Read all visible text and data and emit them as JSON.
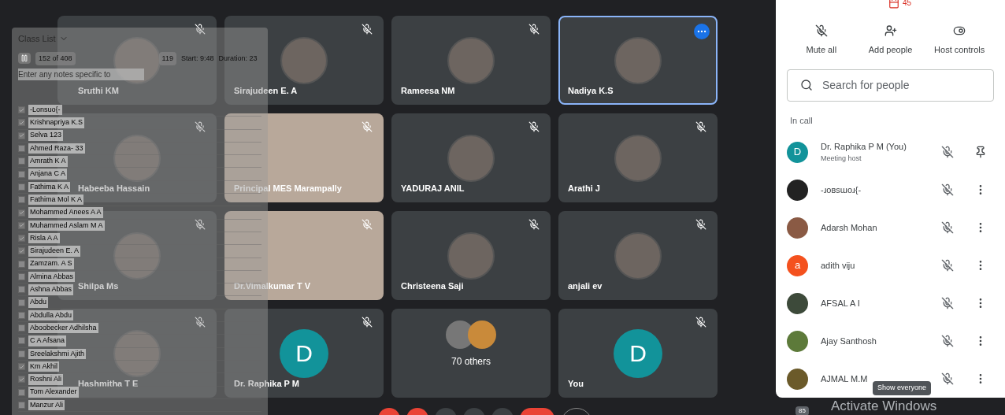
{
  "tiles": [
    {
      "name": "Sruthi KM",
      "kind": "photo",
      "muted": true,
      "selected": false
    },
    {
      "name": "Sirajudeen E. A",
      "kind": "photo",
      "muted": true,
      "selected": false
    },
    {
      "name": "Rameesa NM",
      "kind": "photo",
      "muted": true,
      "selected": false
    },
    {
      "name": "Nadiya K.S",
      "kind": "photo",
      "muted": false,
      "selected": true
    },
    {
      "name": "Habeeba Hassain",
      "kind": "photo",
      "muted": true,
      "selected": false
    },
    {
      "name": "Principal MES Marampally",
      "kind": "video",
      "muted": true,
      "selected": false
    },
    {
      "name": "YADURAJ ANIL",
      "kind": "photo",
      "muted": true,
      "selected": false
    },
    {
      "name": "Arathi J",
      "kind": "photo",
      "muted": true,
      "selected": false
    },
    {
      "name": "Shilpa Ms",
      "kind": "photo",
      "muted": true,
      "selected": false
    },
    {
      "name": "Dr.Vimalkumar T V",
      "kind": "video",
      "muted": true,
      "selected": false
    },
    {
      "name": "Christeena Saji",
      "kind": "photo",
      "muted": true,
      "selected": false
    },
    {
      "name": "anjali ev",
      "kind": "photo",
      "muted": true,
      "selected": false
    },
    {
      "name": "Hashmitha T E",
      "kind": "photo",
      "muted": true,
      "selected": false
    },
    {
      "name": "Dr. Raphika P M",
      "kind": "letter",
      "letter": "D",
      "muted": true,
      "selected": false
    },
    {
      "name": "70 others",
      "kind": "group",
      "muted": false,
      "selected": false
    },
    {
      "name": "You",
      "kind": "letter",
      "letter": "D",
      "muted": true,
      "selected": false
    }
  ],
  "class_list": {
    "title": "Class List",
    "count": "152 of 408",
    "count_2": "119",
    "start": "Start: 9:48",
    "duration": "Duration: 23",
    "notes_placeholder": "Enter any notes specific to",
    "rows": [
      {
        "name": "-Lonsuo{-",
        "checked": true
      },
      {
        "name": "Krishnapriya K.S",
        "checked": true
      },
      {
        "name": "Selva 123",
        "checked": true
      },
      {
        "name": "Ahmed Raza- 33",
        "checked": false
      },
      {
        "name": "Amrath K A",
        "checked": false
      },
      {
        "name": "Anjana C A",
        "checked": false
      },
      {
        "name": "Fathima K A",
        "checked": false
      },
      {
        "name": "Fathima Mol K A",
        "checked": false
      },
      {
        "name": "Mohammed Anees A A",
        "checked": true
      },
      {
        "name": "Muhammed Aslam M A",
        "checked": true
      },
      {
        "name": "Risla A A",
        "checked": true
      },
      {
        "name": "Sirajudeen E. A",
        "checked": true
      },
      {
        "name": "Zamzam. A S",
        "checked": false
      },
      {
        "name": "Almina Abbas",
        "checked": false
      },
      {
        "name": "Ashna Abbas",
        "checked": false
      },
      {
        "name": "Abdu",
        "checked": false
      },
      {
        "name": "Abdulla Abdu",
        "checked": false
      },
      {
        "name": "Aboobecker Adhilsha",
        "checked": false
      },
      {
        "name": "C A Afsana",
        "checked": false
      },
      {
        "name": "Sreelakshmi Ajith",
        "checked": false
      },
      {
        "name": "Km Akhil",
        "checked": true
      },
      {
        "name": "Roshni Ali",
        "checked": true
      },
      {
        "name": "Tom Alexander",
        "checked": false
      },
      {
        "name": "Manzur Ali",
        "checked": false
      }
    ]
  },
  "panel": {
    "top_count": "45",
    "actions": [
      "Mute all",
      "Add people",
      "Host controls"
    ],
    "search_placeholder": "Search for people",
    "section": "In call",
    "people": [
      {
        "name": "Dr. Raphika P M (You)",
        "subtitle": "Meeting host",
        "kind": "letter",
        "letter": "D",
        "color": "#12939a",
        "pinnable": true
      },
      {
        "name": "-ɹoʙsɯoɹ{-",
        "kind": "photo",
        "color": "#222222",
        "pinnable": false
      },
      {
        "name": "Adarsh Mohan",
        "kind": "photo",
        "color": "#8a5a44",
        "pinnable": false
      },
      {
        "name": "adith viju",
        "kind": "letter",
        "letter": "a",
        "color": "#f4511e",
        "pinnable": false
      },
      {
        "name": "AFSAL A I",
        "kind": "photo",
        "color": "#3d4a3a",
        "pinnable": false
      },
      {
        "name": "Ajay Santhosh",
        "kind": "photo",
        "color": "#5d7a3a",
        "pinnable": false
      },
      {
        "name": "AJMAL M.M",
        "kind": "photo",
        "color": "#6b5a2a",
        "pinnable": false
      }
    ]
  },
  "tooltip": "Show everyone",
  "badge": "85",
  "os_notice": "Activate Windows"
}
